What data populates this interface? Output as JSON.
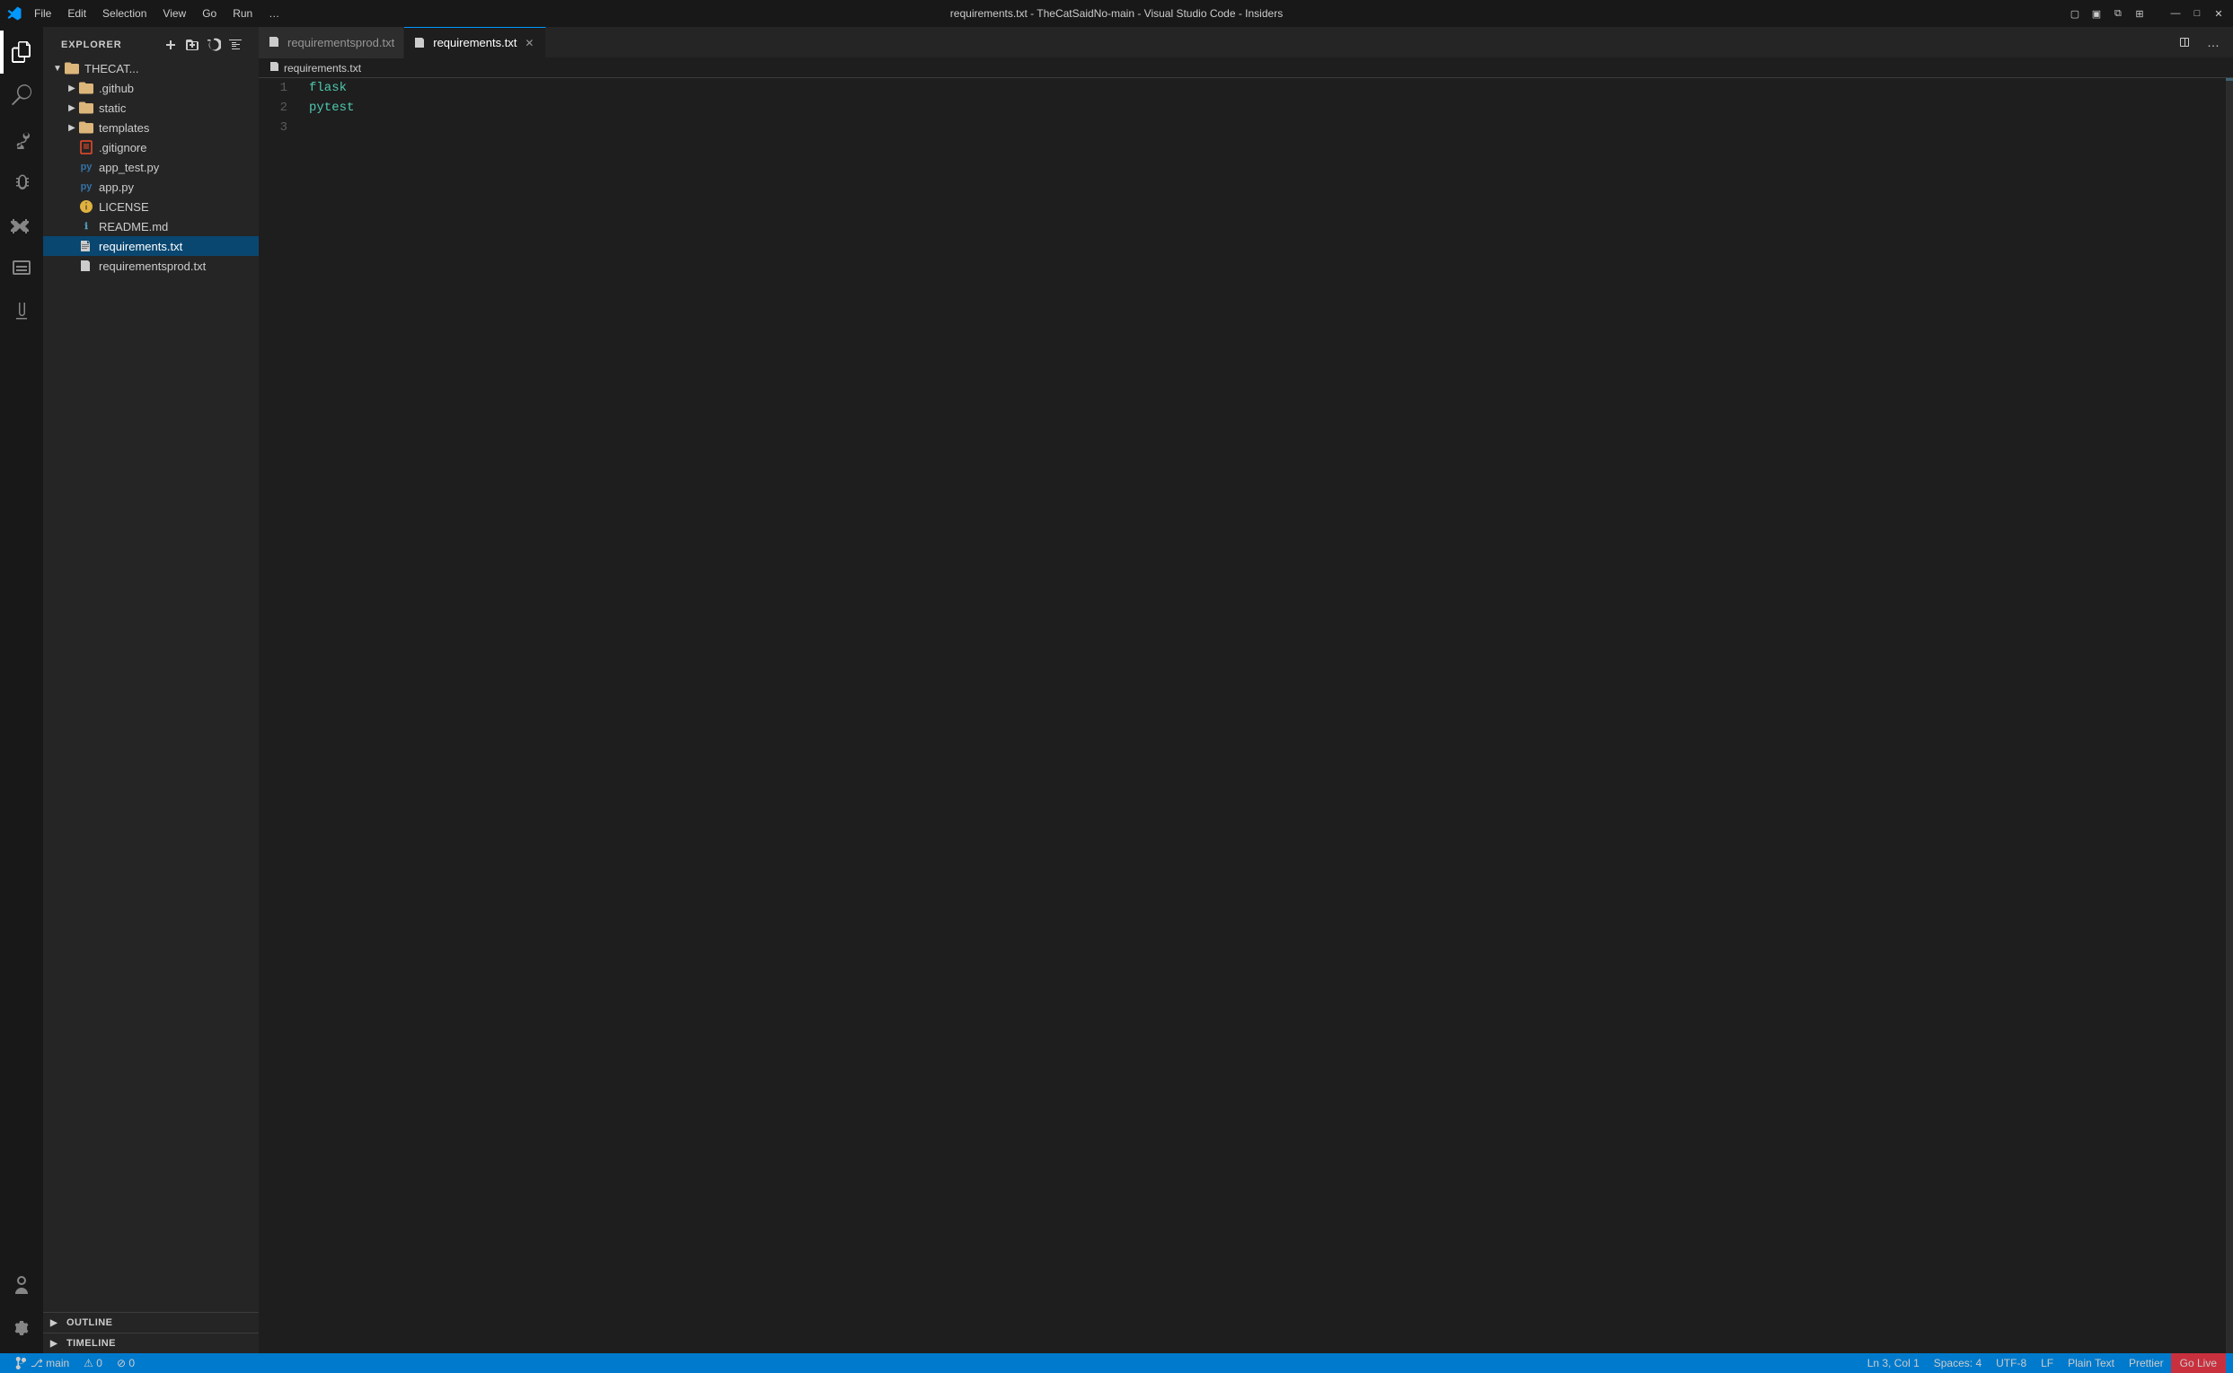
{
  "titlebar": {
    "title": "requirements.txt - TheCatSaidNo-main - Visual Studio Code - Insiders",
    "menus": [
      "File",
      "Edit",
      "Selection",
      "View",
      "Go",
      "Run",
      "…"
    ]
  },
  "activity_bar": {
    "items": [
      {
        "name": "explorer",
        "icon": "⬜",
        "label": "Explorer",
        "active": true
      },
      {
        "name": "search",
        "icon": "🔍",
        "label": "Search"
      },
      {
        "name": "git",
        "icon": "⑂",
        "label": "Source Control"
      },
      {
        "name": "debug",
        "icon": "▷",
        "label": "Run and Debug"
      },
      {
        "name": "extensions",
        "icon": "⧉",
        "label": "Extensions"
      },
      {
        "name": "remote",
        "icon": "⊞",
        "label": "Remote Explorer"
      },
      {
        "name": "test",
        "icon": "⚗",
        "label": "Testing"
      }
    ],
    "bottom": [
      {
        "name": "account",
        "icon": "👤",
        "label": "Account"
      },
      {
        "name": "settings",
        "icon": "⚙",
        "label": "Settings"
      }
    ]
  },
  "sidebar": {
    "header": "EXPLORER",
    "header_actions": [
      "new-file",
      "new-folder",
      "refresh",
      "collapse"
    ],
    "root": {
      "label": "THECAT...",
      "expanded": true
    },
    "tree": [
      {
        "type": "folder",
        "label": ".github",
        "depth": 1,
        "expanded": false
      },
      {
        "type": "folder",
        "label": "static",
        "depth": 1,
        "expanded": false
      },
      {
        "type": "folder",
        "label": "templates",
        "depth": 1,
        "expanded": false
      },
      {
        "type": "file",
        "label": ".gitignore",
        "depth": 1,
        "icon": "gitignore"
      },
      {
        "type": "file",
        "label": "app_test.py",
        "depth": 1,
        "icon": "py"
      },
      {
        "type": "file",
        "label": "app.py",
        "depth": 1,
        "icon": "py"
      },
      {
        "type": "file",
        "label": "LICENSE",
        "depth": 1,
        "icon": "license"
      },
      {
        "type": "file",
        "label": "README.md",
        "depth": 1,
        "icon": "md"
      },
      {
        "type": "file",
        "label": "requirements.txt",
        "depth": 1,
        "icon": "txt",
        "selected": true
      },
      {
        "type": "file",
        "label": "requirementsprod.txt",
        "depth": 1,
        "icon": "txt"
      }
    ],
    "sections": [
      {
        "label": "OUTLINE",
        "expanded": false
      },
      {
        "label": "TIMELINE",
        "expanded": false
      }
    ]
  },
  "tabs": [
    {
      "label": "requirementsprod.txt",
      "icon": "txt",
      "active": false,
      "closeable": false
    },
    {
      "label": "requirements.txt",
      "icon": "txt",
      "active": true,
      "closeable": true
    }
  ],
  "breadcrumb": {
    "text": "requirements.txt"
  },
  "editor": {
    "lines": [
      {
        "number": "1",
        "content": "flask",
        "type": "package"
      },
      {
        "number": "2",
        "content": "pytest",
        "type": "package"
      },
      {
        "number": "3",
        "content": "",
        "type": "empty"
      }
    ]
  },
  "status_bar": {
    "left": [
      {
        "text": "⎇ main"
      },
      {
        "text": "⚠ 0"
      },
      {
        "text": "⊘ 0"
      }
    ],
    "right": [
      {
        "text": "Ln 3, Col 1"
      },
      {
        "text": "Spaces: 4"
      },
      {
        "text": "UTF-8"
      },
      {
        "text": "LF"
      },
      {
        "text": "Plain Text"
      },
      {
        "text": "Prettier"
      },
      {
        "text": "Go Live"
      }
    ]
  }
}
